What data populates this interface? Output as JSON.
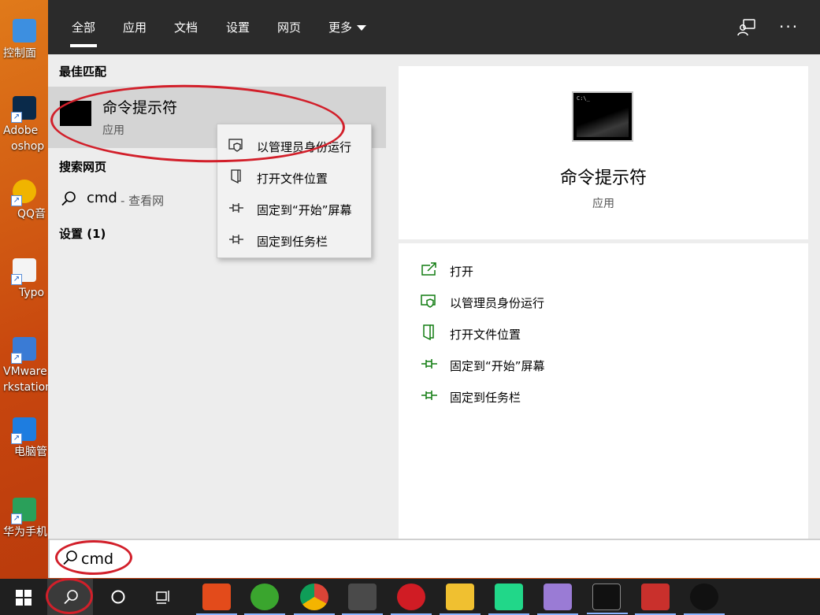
{
  "desktop": {
    "icons": [
      {
        "label": "控制面",
        "color": "#3d8fe0"
      },
      {
        "label": "Adobe",
        "label2": "oshop",
        "color": "#0a2a4a"
      },
      {
        "label": "QQ音",
        "color": "#f0b400"
      },
      {
        "label": "Typo",
        "color": "#f4f4f4"
      },
      {
        "label": "VMware",
        "label2": "rkstation",
        "color": "#3a7bd5"
      },
      {
        "label": "电脑管",
        "color": "#1e7de0"
      },
      {
        "label": "华为手机",
        "color": "#2aa05a"
      }
    ]
  },
  "tabs": [
    {
      "label": "全部",
      "active": true
    },
    {
      "label": "应用"
    },
    {
      "label": "文档"
    },
    {
      "label": "设置"
    },
    {
      "label": "网页"
    },
    {
      "label": "更多"
    }
  ],
  "sections": {
    "best_match": "最佳匹配",
    "search_web": "搜索网页",
    "settings": "设置 (1)"
  },
  "best_match": {
    "title": "命令提示符",
    "subtitle": "应用"
  },
  "web_result": {
    "query": "cmd",
    "suffix": " - 查看网"
  },
  "context_menu": {
    "items": [
      {
        "label": "以管理员身份运行",
        "icon": "shield-icon"
      },
      {
        "label": "打开文件位置",
        "icon": "folder-icon"
      },
      {
        "label": "固定到“开始”屏幕",
        "icon": "pin-icon"
      },
      {
        "label": "固定到任务栏",
        "icon": "pin-icon"
      }
    ]
  },
  "detail": {
    "title": "命令提示符",
    "subtitle": "应用",
    "prompt_text": "C:\\_",
    "actions": [
      {
        "label": "打开",
        "icon": "open-icon"
      },
      {
        "label": "以管理员身份运行",
        "icon": "shield-icon"
      },
      {
        "label": "打开文件位置",
        "icon": "folder-icon"
      },
      {
        "label": "固定到“开始”屏幕",
        "icon": "pin-icon"
      },
      {
        "label": "固定到任务栏",
        "icon": "pin-icon"
      }
    ]
  },
  "search": {
    "value": "cmd"
  },
  "colors": {
    "topbar": "#2b2b2b",
    "accent_green": "#107c10",
    "annotation_red": "#d21f2a"
  }
}
